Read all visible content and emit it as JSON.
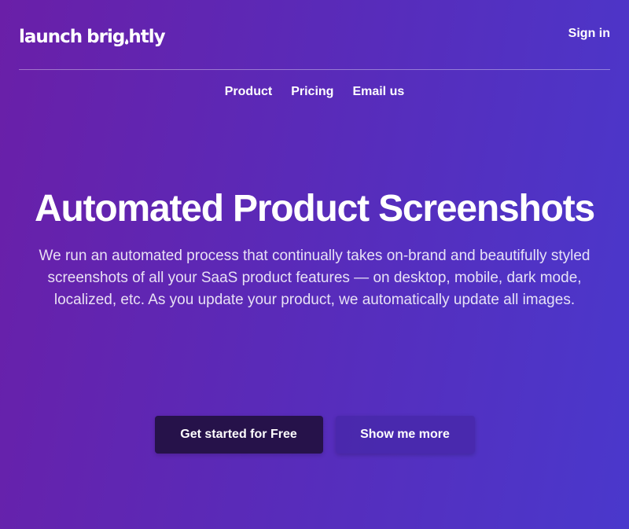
{
  "brand": {
    "logo_part1": "launch",
    "logo_part2": "brig",
    "logo_part3": "htly",
    "logo_text": "launchbrightly"
  },
  "header": {
    "signin_label": "Sign in"
  },
  "nav": {
    "items": [
      {
        "label": "Product"
      },
      {
        "label": "Pricing"
      },
      {
        "label": "Email us"
      }
    ]
  },
  "hero": {
    "title": "Automated Product Screenshots",
    "subtitle": "We run an automated process that continually takes on-brand and beautifully styled screenshots of all your SaaS product features — on desktop, mobile, dark mode, localized, etc. As you update your product, we automatically update all images."
  },
  "cta": {
    "primary_label": "Get started for Free",
    "secondary_label": "Show me more"
  },
  "colors": {
    "gradient_start": "#6a1fa8",
    "gradient_end": "#4a38cc",
    "primary_button": "#26124a",
    "secondary_button": "#4828aa"
  }
}
